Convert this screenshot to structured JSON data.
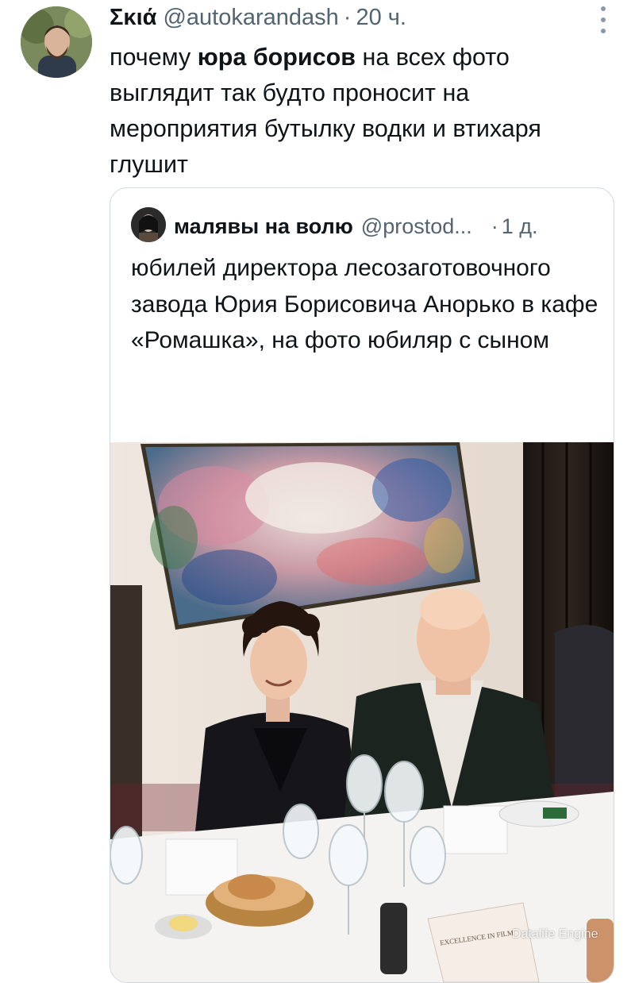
{
  "tweet": {
    "author_name": "Σκιά",
    "handle": "@autokarandash",
    "separator": "·",
    "time": "20 ч.",
    "text_before": "почему ",
    "text_bold": "юра борисов",
    "text_after": " на всех фото выглядит так будто проносит на мероприятия бутылку водки и втихаря глушит"
  },
  "quoted_tweet": {
    "author_name": "малявы на волю",
    "handle": "@prostod...",
    "separator": "·",
    "time": "1 д.",
    "text": "юбилей директора лесозаготовочного завода Юрия Борисовича Анорько в кафе «Ромашка», на фото юбиляр с сыном"
  },
  "photo": {
    "menu_card_text": "EXCELLENCE IN FILM"
  },
  "watermark": "Datalife Engine",
  "colors": {
    "text": "#0f1419",
    "secondary": "#536471",
    "border": "#cfd9de"
  },
  "icons": [
    "more-icon"
  ]
}
